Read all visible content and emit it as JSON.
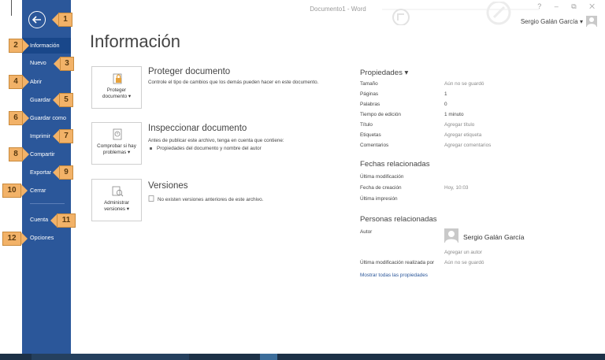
{
  "window": {
    "title": "Documento1 - Word",
    "controls": "? – ⧉ ✕",
    "user_name": "Sergio Galán García ▾"
  },
  "sidebar": {
    "items": [
      {
        "label": "Información"
      },
      {
        "label": "Nuevo"
      },
      {
        "label": "Abrir"
      },
      {
        "label": "Guardar"
      },
      {
        "label": "Guardar como"
      },
      {
        "label": "Imprimir"
      },
      {
        "label": "Compartir"
      },
      {
        "label": "Exportar"
      },
      {
        "label": "Cerrar"
      },
      {
        "label": "Cuenta"
      },
      {
        "label": "Opciones"
      }
    ]
  },
  "callouts": [
    "1",
    "2",
    "3",
    "4",
    "5",
    "6",
    "7",
    "8",
    "9",
    "10",
    "11",
    "12"
  ],
  "main": {
    "title": "Información",
    "protect": {
      "card_label_1": "Proteger",
      "card_label_2": "documento ▾",
      "heading": "Proteger documento",
      "desc": "Controle el tipo de cambios que los demás pueden hacer en este documento."
    },
    "inspect": {
      "card_label_1": "Comprobar si hay",
      "card_label_2": "problemas ▾",
      "heading": "Inspeccionar documento",
      "desc": "Antes de publicar este archivo, tenga en cuenta que contiene:",
      "bullet": "Propiedades del documento y nombre del autor"
    },
    "versions": {
      "card_label_1": "Administrar",
      "card_label_2": "versiones ▾",
      "heading": "Versiones",
      "desc": "No existen versiones anteriores de este archivo."
    }
  },
  "properties": {
    "heading": "Propiedades ▾",
    "rows": [
      {
        "label": "Tamaño",
        "value": "Aún no se guardó"
      },
      {
        "label": "Páginas",
        "value": "1"
      },
      {
        "label": "Palabras",
        "value": "0"
      },
      {
        "label": "Tiempo de edición",
        "value": "1 minuto"
      },
      {
        "label": "Título",
        "value": "Agregar título"
      },
      {
        "label": "Etiquetas",
        "value": "Agregar etiqueta"
      },
      {
        "label": "Comentarios",
        "value": "Agregar comentarios"
      }
    ],
    "dates_heading": "Fechas relacionadas",
    "dates": [
      {
        "label": "Última modificación",
        "value": ""
      },
      {
        "label": "Fecha de creación",
        "value": "Hoy, 10:03"
      },
      {
        "label": "Última impresión",
        "value": ""
      }
    ],
    "people_heading": "Personas relacionadas",
    "author_label": "Autor",
    "author_name": "Sergio Galán García",
    "add_author": "Agregar un autor",
    "last_modified_by_label": "Última modificación realizada por",
    "last_modified_by_value": "Aún no se guardó",
    "show_all": "Mostrar todas las propiedades"
  },
  "colors": {
    "sidebar": "#2b579a",
    "sidebar_active": "#19478a",
    "callout": "#f2b268",
    "link": "#2b579a"
  }
}
